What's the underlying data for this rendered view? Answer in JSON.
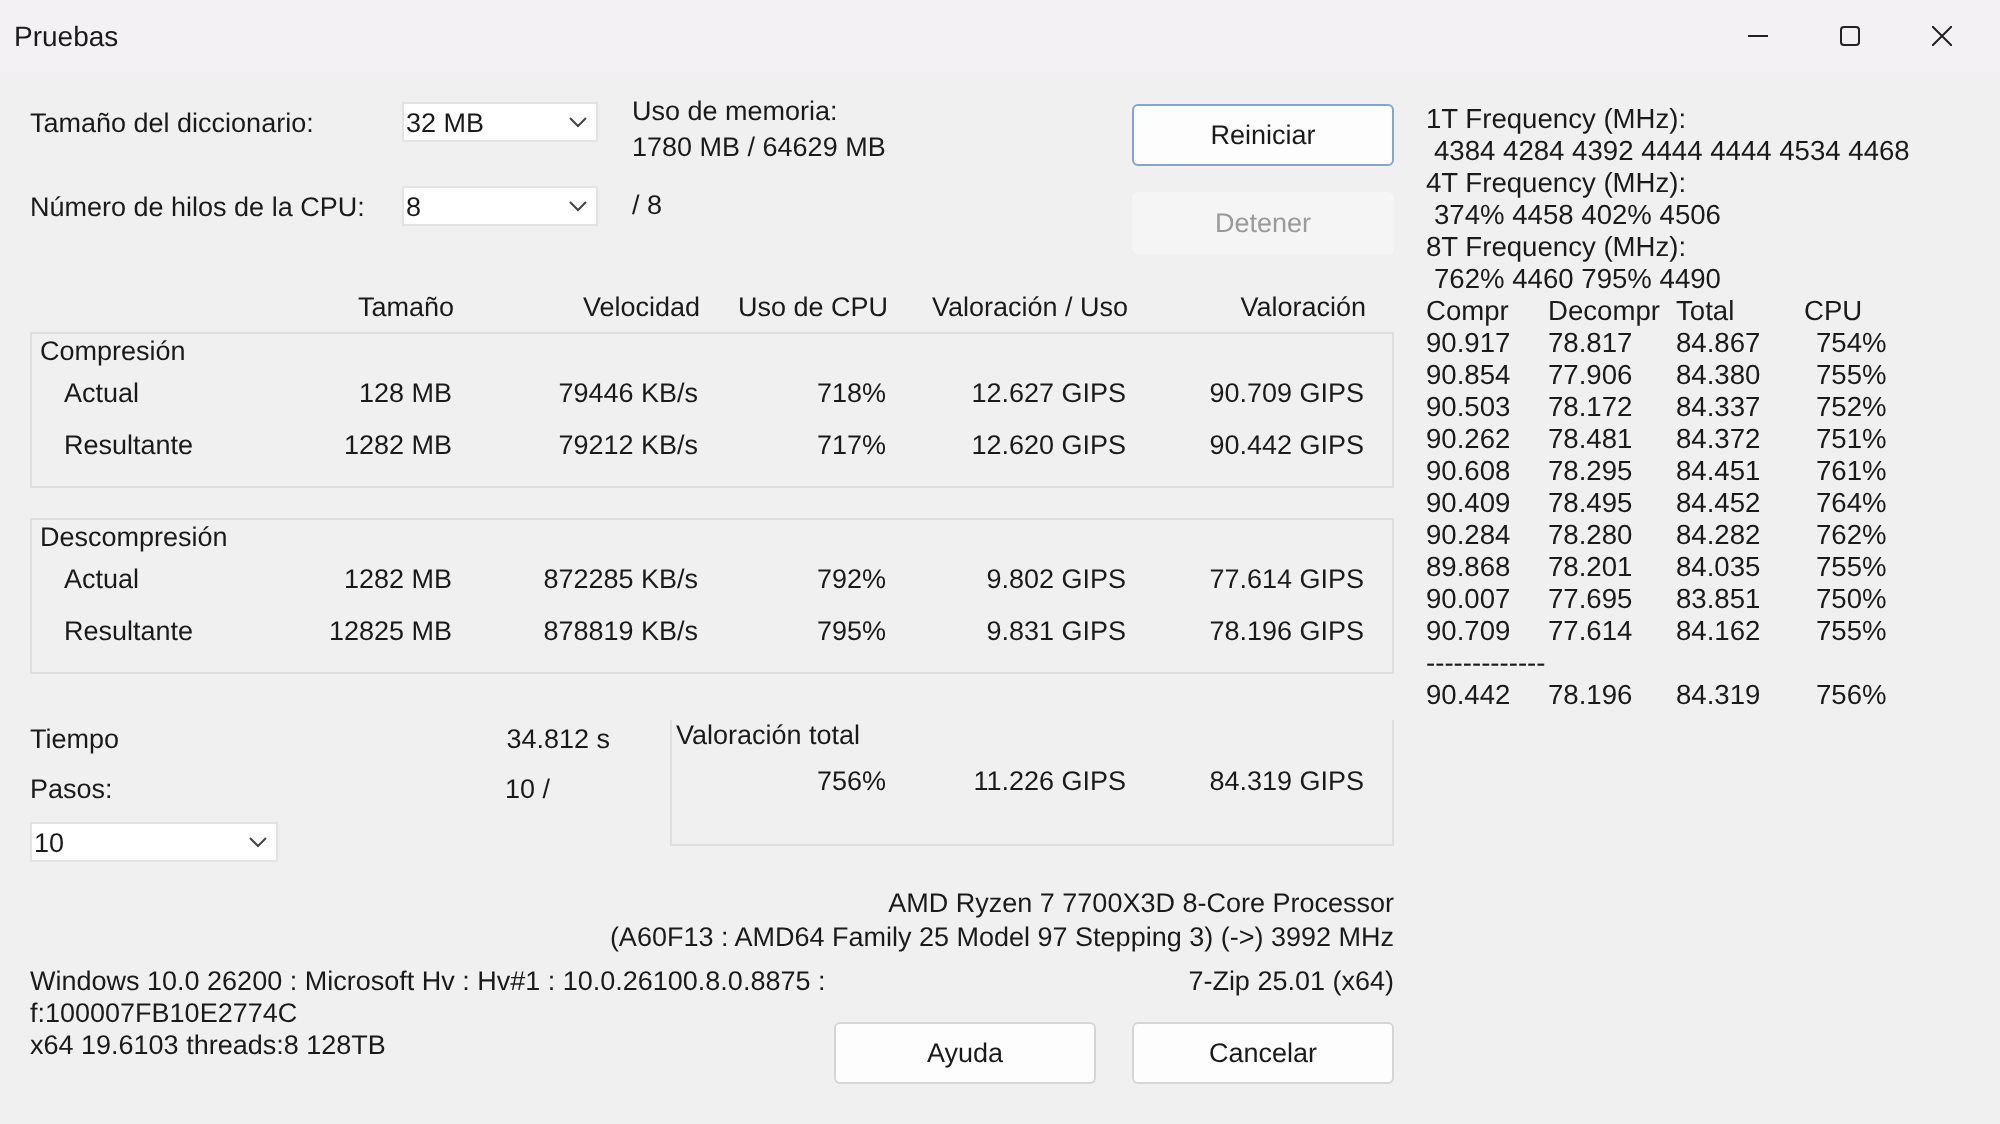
{
  "window": {
    "title": "Pruebas"
  },
  "dictionary": {
    "label": "Tamaño del diccionario:",
    "value": "32 MB"
  },
  "memory": {
    "label": "Uso de memoria:",
    "value": "1780 MB / 64629 MB"
  },
  "threads": {
    "label": "Número de hilos de la CPU:",
    "value": "8",
    "max": "/ 8"
  },
  "top_buttons": [
    {
      "label": "Reiniciar",
      "disabled": false,
      "focused": true
    },
    {
      "label": "Detener",
      "disabled": true,
      "focused": false
    }
  ],
  "table": {
    "columns": [
      "Tamaño",
      "Velocidad",
      "Uso de CPU",
      "Valoración / Uso",
      "Valoración"
    ],
    "groups": [
      {
        "title": "Compresión",
        "rows": [
          {
            "label": "Actual",
            "cells": [
              "128 MB",
              "79446 KB/s",
              "718%",
              "12.627 GIPS",
              "90.709 GIPS"
            ]
          },
          {
            "label": "Resultante",
            "cells": [
              "1282 MB",
              "79212 KB/s",
              "717%",
              "12.620 GIPS",
              "90.442 GIPS"
            ]
          }
        ]
      },
      {
        "title": "Descompresión",
        "rows": [
          {
            "label": "Actual",
            "cells": [
              "1282 MB",
              "872285 KB/s",
              "792%",
              "9.802 GIPS",
              "77.614 GIPS"
            ]
          },
          {
            "label": "Resultante",
            "cells": [
              "12825 MB",
              "878819 KB/s",
              "795%",
              "9.831 GIPS",
              "78.196 GIPS"
            ]
          }
        ]
      }
    ]
  },
  "time": {
    "label": "Tiempo",
    "value": "34.812 s"
  },
  "passes": {
    "label": "Pasos:",
    "value": "10 /",
    "select": "10"
  },
  "total": {
    "label": "Valoración total",
    "cells": [
      "756%",
      "11.226 GIPS",
      "84.319 GIPS"
    ]
  },
  "cpu_info": [
    "AMD Ryzen 7 7700X3D 8-Core Processor",
    "(A60F13 : AMD64 Family 25 Model 97 Stepping 3) (->) 3992 MHz"
  ],
  "system_info": [
    "Windows 10.0 26200 : Microsoft Hv : Hv#1 : 10.0.26100.8.0.8875 :",
    "f:100007FB10E2774C",
    "x64 19.6103 threads:8 128TB"
  ],
  "version": "7-Zip 25.01 (x64)",
  "bottom_buttons": [
    {
      "label": "Ayuda"
    },
    {
      "label": "Cancelar"
    }
  ],
  "log": {
    "frequencies": [
      {
        "label": "1T Frequency (MHz):",
        "values": "4384 4284 4392 4444 4444 4534 4468"
      },
      {
        "label": "4T Frequency (MHz):",
        "values": "374% 4458 402% 4506"
      },
      {
        "label": "8T Frequency (MHz):",
        "values": "762% 4460 795% 4490"
      }
    ],
    "columns": [
      "Compr",
      "Decompr",
      "Total",
      "CPU"
    ],
    "rows": [
      [
        "90.917",
        "78.817",
        "84.867",
        "754%"
      ],
      [
        "90.854",
        "77.906",
        "84.380",
        "755%"
      ],
      [
        "90.503",
        "78.172",
        "84.337",
        "752%"
      ],
      [
        "90.262",
        "78.481",
        "84.372",
        "751%"
      ],
      [
        "90.608",
        "78.295",
        "84.451",
        "761%"
      ],
      [
        "90.409",
        "78.495",
        "84.452",
        "764%"
      ],
      [
        "90.284",
        "78.280",
        "84.282",
        "762%"
      ],
      [
        "89.868",
        "78.201",
        "84.035",
        "755%"
      ],
      [
        "90.007",
        "77.695",
        "83.851",
        "750%"
      ],
      [
        "90.709",
        "77.614",
        "84.162",
        "755%"
      ]
    ],
    "separator": "-------------",
    "summary": [
      "90.442",
      "78.196",
      "84.319",
      "756%"
    ]
  }
}
